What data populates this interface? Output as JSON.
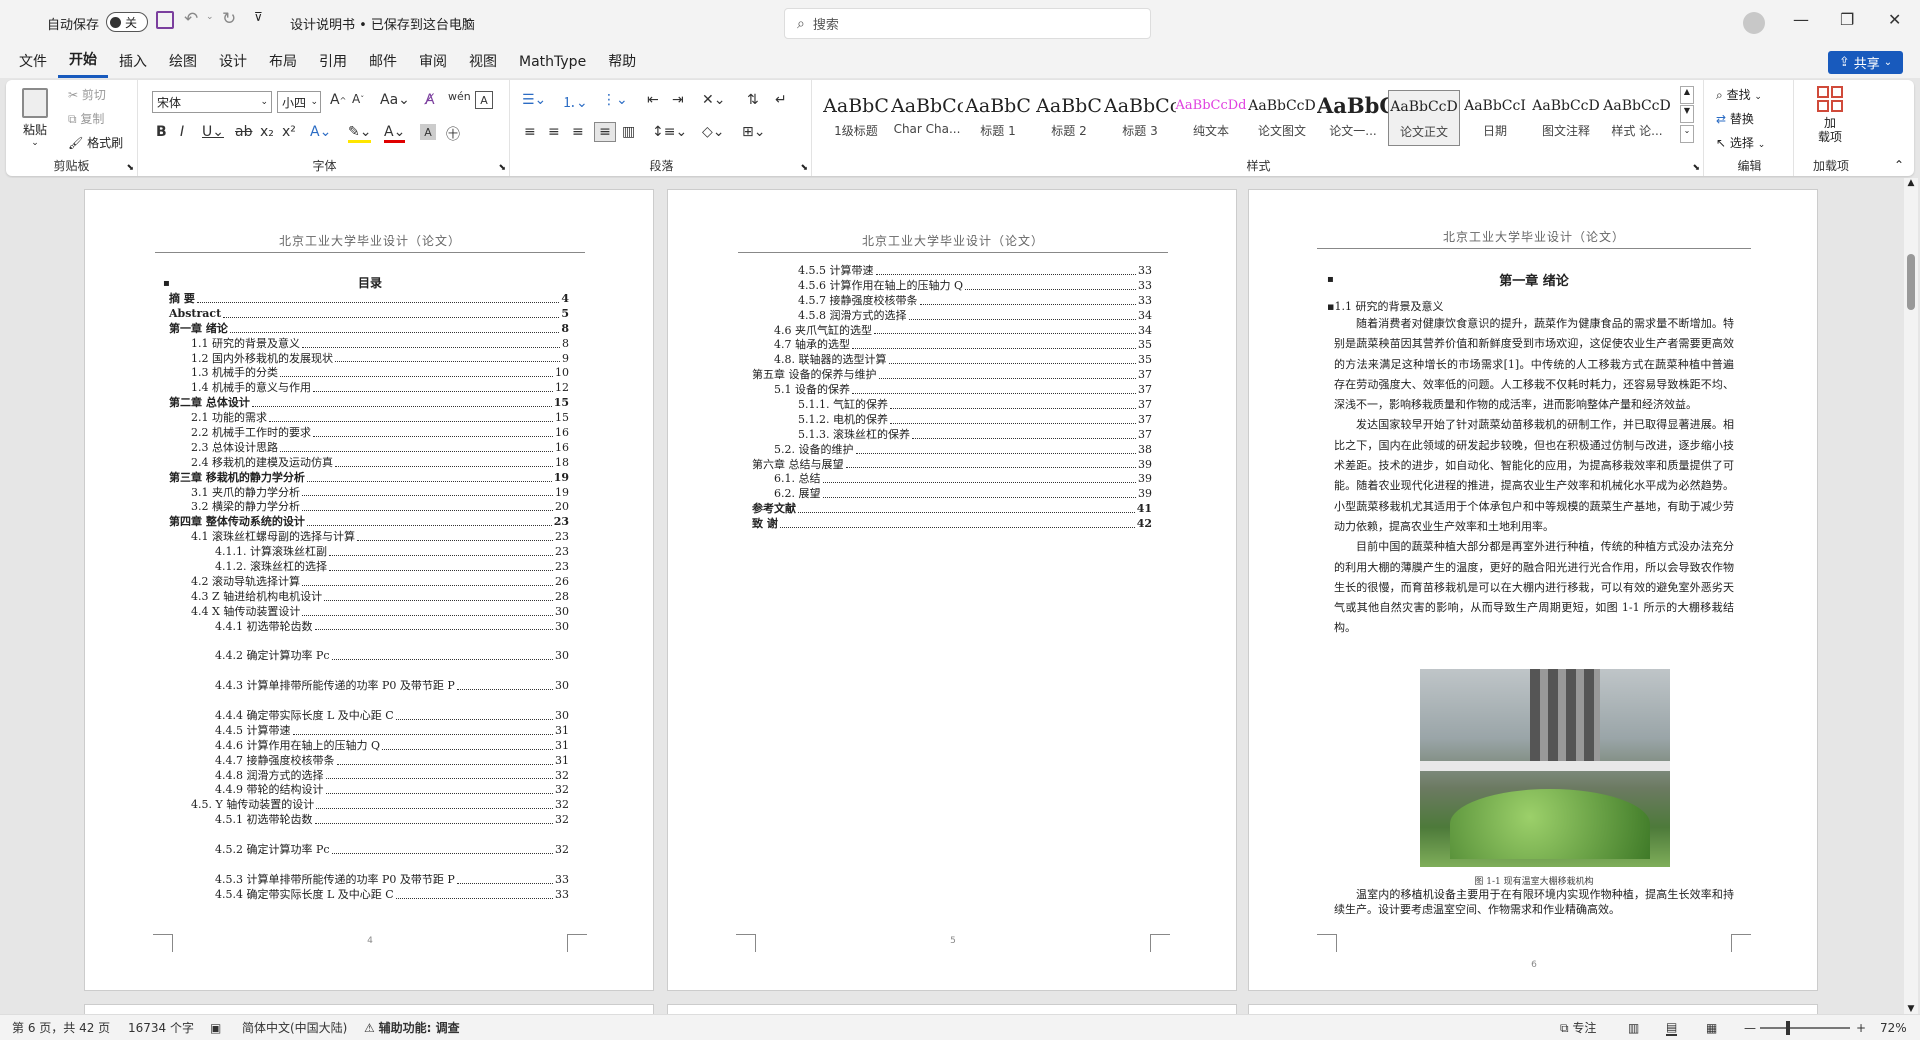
{
  "titlebar": {
    "autosave_label": "自动保存",
    "autosave_state": "关",
    "doc_title": "设计说明书 • 已保存到这台电脑",
    "search_placeholder": "搜索"
  },
  "menu": [
    "文件",
    "开始",
    "插入",
    "绘图",
    "设计",
    "布局",
    "引用",
    "邮件",
    "审阅",
    "视图",
    "MathType",
    "帮助"
  ],
  "share_label": "共享",
  "ribbon": {
    "clipboard": {
      "paste": "粘贴",
      "cut": "剪切",
      "copy": "复制",
      "format_painter": "格式刷",
      "label": "剪贴板"
    },
    "font": {
      "name": "宋体",
      "size": "小四",
      "label": "字体"
    },
    "paragraph": {
      "label": "段落"
    },
    "styles": {
      "label": "样式",
      "items": [
        {
          "prev": "AaBbC",
          "name": "1级标题"
        },
        {
          "prev": "AaBbCcI",
          "name": "Char Cha..."
        },
        {
          "prev": "AaBbC",
          "name": "标题 1"
        },
        {
          "prev": "AaBbC",
          "name": "标题 2"
        },
        {
          "prev": "AaBbCcI",
          "name": "标题 3"
        },
        {
          "prev": "AaBbCcDd",
          "name": "纯文本"
        },
        {
          "prev": "AaBbCcD",
          "name": "论文图文"
        },
        {
          "prev": "AaBbC",
          "name": "论文一..."
        },
        {
          "prev": "AaBbCcD",
          "name": "论文正文"
        },
        {
          "prev": "AaBbCcI",
          "name": "日期"
        },
        {
          "prev": "AaBbCcD",
          "name": "图文注释"
        },
        {
          "prev": "AaBbCcD",
          "name": "样式 论..."
        }
      ]
    },
    "editing": {
      "find": "查找",
      "replace": "替换",
      "select": "选择",
      "label": "编辑"
    },
    "addins": {
      "btn": "加\n载项",
      "label": "加载项"
    }
  },
  "page_header_1": "北京工业大学毕业设计（论文）",
  "page_header_3": "北京工业大学毕业设计（论文）",
  "toc_title": "目录",
  "toc1": [
    {
      "t": "摘  要",
      "p": "4",
      "lv": 0,
      "b": true
    },
    {
      "t": "Abstract",
      "p": "5",
      "lv": 0,
      "b": true
    },
    {
      "t": "第一章   绪论",
      "p": "8",
      "lv": 0,
      "b": true
    },
    {
      "t": "1.1  研究的背景及意义",
      "p": "8",
      "lv": 1
    },
    {
      "t": "1.2  国内外移栽机的发展现状",
      "p": "9",
      "lv": 1
    },
    {
      "t": "1.3  机械手的分类",
      "p": "10",
      "lv": 1
    },
    {
      "t": "1.4  机械手的意义与作用",
      "p": "12",
      "lv": 1
    },
    {
      "t": "第二章   总体设计",
      "p": "15",
      "lv": 0,
      "b": true
    },
    {
      "t": "2.1  功能的需求",
      "p": "15",
      "lv": 1
    },
    {
      "t": "2.2  机械手工作时的要求",
      "p": "16",
      "lv": 1
    },
    {
      "t": "2.3  总体设计思路",
      "p": "16",
      "lv": 1
    },
    {
      "t": "2.4  移栽机的建模及运动仿真",
      "p": "18",
      "lv": 1
    },
    {
      "t": "第三章   移栽机的静力学分析",
      "p": "19",
      "lv": 0,
      "b": true
    },
    {
      "t": "3.1  夹爪的静力学分析",
      "p": "19",
      "lv": 1
    },
    {
      "t": "3.2  横梁的静力学分析",
      "p": "20",
      "lv": 1
    },
    {
      "t": "第四章   整体传动系统的设计",
      "p": "23",
      "lv": 0,
      "b": true
    },
    {
      "t": "4.1  滚珠丝杠螺母副的选择与计算",
      "p": "23",
      "lv": 1
    },
    {
      "t": "4.1.1.  计算滚珠丝杠副",
      "p": "23",
      "lv": 2
    },
    {
      "t": "4.1.2.  滚珠丝杠的选择",
      "p": "23",
      "lv": 2
    },
    {
      "t": "4.2  滚动导轨选择计算",
      "p": "26",
      "lv": 1
    },
    {
      "t": "4.3 Z 轴进给机构电机设计",
      "p": "28",
      "lv": 1
    },
    {
      "t": "4.4 X 轴传动装置设计",
      "p": "30",
      "lv": 1
    },
    {
      "t": "4.4.1  初选带轮齿数",
      "p": "30",
      "lv": 2
    },
    {
      "t": "4.4.2  确定计算功率 Pc",
      "p": "30",
      "lv": 2,
      "tall": true
    },
    {
      "t": "4.4.3  计算单排带所能传递的功率 P0 及带节距 P",
      "p": "30",
      "lv": 2,
      "tall": true
    },
    {
      "t": "4.4.4  确定带实际长度 L 及中心距 C",
      "p": "30",
      "lv": 2,
      "tall": true
    },
    {
      "t": "4.4.5  计算带速",
      "p": "31",
      "lv": 2
    },
    {
      "t": "4.4.6  计算作用在轴上的压轴力 Q",
      "p": "31",
      "lv": 2
    },
    {
      "t": "4.4.7  接静强度校核带条",
      "p": "31",
      "lv": 2
    },
    {
      "t": "4.4.8  润滑方式的选择",
      "p": "32",
      "lv": 2
    },
    {
      "t": "4.4.9  带轮的结构设计",
      "p": "32",
      "lv": 2
    },
    {
      "t": "4.5. Y 轴传动装置的设计",
      "p": "32",
      "lv": 1
    },
    {
      "t": "4.5.1  初选带轮齿数",
      "p": "32",
      "lv": 2
    },
    {
      "t": "4.5.2  确定计算功率 Pc",
      "p": "32",
      "lv": 2,
      "tall": true
    },
    {
      "t": "4.5.3  计算单排带所能传递的功率 P0 及带节距 P",
      "p": "33",
      "lv": 2,
      "tall": true
    },
    {
      "t": "4.5.4  确定带实际长度 L 及中心距 C",
      "p": "33",
      "lv": 2
    }
  ],
  "toc2": [
    {
      "t": "4.5.5  计算带速",
      "p": "33",
      "lv": 2
    },
    {
      "t": "4.5.6  计算作用在轴上的压轴力 Q",
      "p": "33",
      "lv": 2
    },
    {
      "t": "4.5.7  接静强度校核带条",
      "p": "33",
      "lv": 2
    },
    {
      "t": "4.5.8  润滑方式的选择",
      "p": "34",
      "lv": 2
    },
    {
      "t": "4.6  夹爪气缸的选型",
      "p": "34",
      "lv": 1
    },
    {
      "t": "4.7  轴承的选型",
      "p": "35",
      "lv": 1
    },
    {
      "t": "4.8.  联轴器的选型计算",
      "p": "35",
      "lv": 1
    },
    {
      "t": "第五章  设备的保养与维护",
      "p": "37",
      "lv": 0
    },
    {
      "t": "5.1  设备的保养",
      "p": "37",
      "lv": 1
    },
    {
      "t": "5.1.1.  气缸的保养",
      "p": "37",
      "lv": 2
    },
    {
      "t": "5.1.2.  电机的保养",
      "p": "37",
      "lv": 2
    },
    {
      "t": "5.1.3.  滚珠丝杠的保养",
      "p": "37",
      "lv": 2
    },
    {
      "t": "5.2.  设备的维护",
      "p": "38",
      "lv": 1
    },
    {
      "t": "第六章  总结与展望",
      "p": "39",
      "lv": 0
    },
    {
      "t": "6.1.  总结",
      "p": "39",
      "lv": 1
    },
    {
      "t": "6.2.  展望",
      "p": "39",
      "lv": 1
    },
    {
      "t": "参考文献",
      "p": "41",
      "lv": 0,
      "b": true
    },
    {
      "t": "致      谢",
      "p": "42",
      "lv": 0,
      "b": true
    }
  ],
  "ch1": {
    "title": "第一章    绪论",
    "section": "1.1  研究的背景及意义",
    "p1": "随着消费者对健康饮食意识的提升，蔬菜作为健康食品的需求量不断增加。特别是蔬菜秧苗因其营养价值和新鲜度受到市场欢迎，这促使农业生产者需要更高效的方法来满足这种增长的市场需求[1]。中传统的人工移栽方式在蔬菜种植中普遍存在劳动强度大、效率低的问题。人工移栽不仅耗时耗力，还容易导致株距不均、深浅不一，影响移栽质量和作物的成活率，进而影响整体产量和经济效益。",
    "p2": "发达国家较早开始了针对蔬菜幼苗移栽机的研制工作，并已取得显著进展。相比之下，国内在此领域的研发起步较晚，但也在积极通过仿制与改进，逐步缩小技术差距。技术的进步，如自动化、智能化的应用，为提高移栽效率和质量提供了可能。随着农业现代化进程的推进，提高农业生产效率和机械化水平成为必然趋势。小型蔬菜移栽机尤其适用于个体承包户和中等规模的蔬菜生产基地，有助于减少劳动力依赖，提高农业生产效率和土地利用率。",
    "p3": "目前中国的蔬菜种植大部分都是再室外进行种植，传统的种植方式没办法充分的利用大棚的薄膜产生的温度，更好的融合阳光进行光合作用，所以会导致农作物生长的很慢，而育苗移栽机是可以在大棚内进行移栽，可以有效的避免室外恶劣天气或其他自然灾害的影响，从而导致生产周期更短，如图 1-1 所示的大棚移栽结构。",
    "caption": "图 1-1  现有温室大棚移栽机构",
    "p4": "温室内的移植机设备主要用于在有限环境内实现作物种植，提高生长效率和持续生产。设计要考虑温室空间、作物需求和作业精确高效。"
  },
  "page_numbers": {
    "p1": "4",
    "p2": "5",
    "p3": "6"
  },
  "status": {
    "page": "第 6 页，共 42 页",
    "words": "16734 个字",
    "lang": "简体中文(中国大陆)",
    "access": "辅助功能: 调查",
    "focus": "专注",
    "zoom": "72%"
  }
}
